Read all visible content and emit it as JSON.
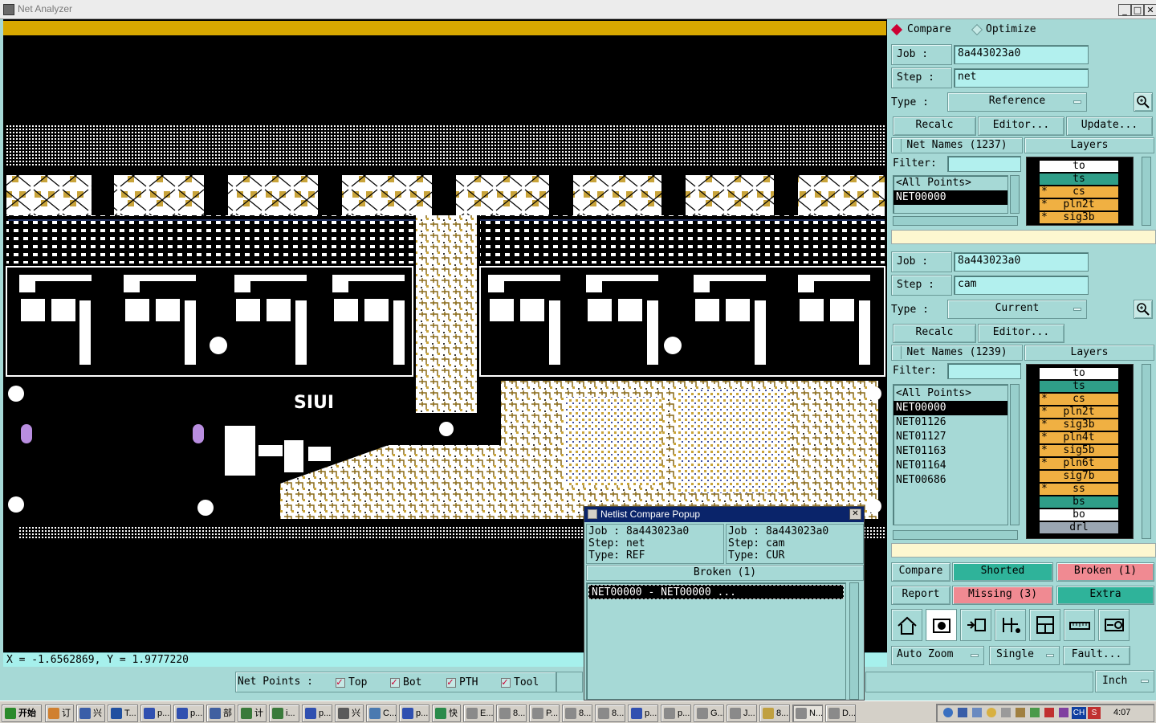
{
  "window": {
    "title": "Net Analyzer"
  },
  "coords": {
    "text": "X = -1.6562869, Y = 1.9777220"
  },
  "netpoints": {
    "label": "Net Points :",
    "top": "Top",
    "bot": "Bot",
    "pth": "PTH",
    "tool": "Tool"
  },
  "units": {
    "label": "Inch"
  },
  "mode": {
    "compare": "Compare",
    "optimize": "Optimize"
  },
  "ref": {
    "job_label": "Job  :",
    "job": "8a443023a0",
    "step_label": "Step  :",
    "step": "net",
    "type_label": "Type  :",
    "type": "Reference",
    "recalc": "Recalc",
    "editor": "Editor...",
    "update": "Update...",
    "netnames": "Net Names (1237)",
    "layers_label": "Layers",
    "filter_label": "Filter:",
    "nets": [
      "<All Points>",
      "NET00000"
    ],
    "layers": [
      {
        "name": "to",
        "star": "",
        "color": "#ffffff"
      },
      {
        "name": "ts",
        "star": "",
        "color": "#2f9e88"
      },
      {
        "name": "cs",
        "star": "*",
        "color": "#f0b042"
      },
      {
        "name": "pln2t",
        "star": "*",
        "color": "#f0b042"
      },
      {
        "name": "sig3b",
        "star": "*",
        "color": "#f0b042"
      }
    ]
  },
  "cur": {
    "job_label": "Job  :",
    "job": "8a443023a0",
    "step_label": "Step  :",
    "step": "cam",
    "type_label": "Type  :",
    "type": "Current",
    "recalc": "Recalc",
    "editor": "Editor...",
    "netnames": "Net Names (1239)",
    "layers_label": "Layers",
    "filter_label": "Filter:",
    "nets": [
      "<All Points>",
      "NET00000",
      "NET01126",
      "NET01127",
      "NET01163",
      "NET01164",
      "NET00686"
    ],
    "layers": [
      {
        "name": "to",
        "star": "",
        "color": "#ffffff"
      },
      {
        "name": "ts",
        "star": "",
        "color": "#2f9e88"
      },
      {
        "name": "cs",
        "star": "*",
        "color": "#f0b042"
      },
      {
        "name": "pln2t",
        "star": "*",
        "color": "#f0b042"
      },
      {
        "name": "sig3b",
        "star": "*",
        "color": "#f0b042"
      },
      {
        "name": "pln4t",
        "star": "*",
        "color": "#f0b042"
      },
      {
        "name": "sig5b",
        "star": "*",
        "color": "#f0b042"
      },
      {
        "name": "pln6t",
        "star": "*",
        "color": "#f0b042"
      },
      {
        "name": "sig7b",
        "star": "",
        "color": "#f0b042"
      },
      {
        "name": "ss",
        "star": "*",
        "color": "#f0b042"
      },
      {
        "name": "bs",
        "star": "",
        "color": "#2f9e88"
      },
      {
        "name": "bo",
        "star": "",
        "color": "#ffffff"
      },
      {
        "name": "drl",
        "star": "",
        "color": "#9aa6b2"
      }
    ]
  },
  "actions": {
    "compare": "Compare",
    "shorted": "Shorted",
    "broken": "Broken (1)",
    "report": "Report",
    "missing": "Missing (3)",
    "extra": "Extra",
    "autozoom": "Auto Zoom",
    "single": "Single",
    "fault": "Fault..."
  },
  "colors": {
    "green": "#2fb39a",
    "pink": "#f08a92",
    "panel": "#a6d9d6",
    "gold": "#d8a800"
  },
  "popup": {
    "title": "Netlist Compare Popup",
    "left": {
      "job": "Job  :  8a443023a0",
      "step": "Step:  net",
      "type": "Type:  REF"
    },
    "right": {
      "job": "Job  :  8a443023a0",
      "step": "Step:  cam",
      "type": "Type:  CUR"
    },
    "header": "Broken (1)",
    "row": "NET00000          - NET00000 ..."
  },
  "taskbar": {
    "start": "开始",
    "items": [
      "订",
      "兴",
      "T...",
      "p...",
      "p...",
      "部",
      "计",
      "i...",
      "p...",
      "兴",
      "C...",
      "p...",
      "快",
      "E...",
      "8...",
      "P...",
      "8...",
      "8...",
      "p...",
      "p...",
      "G...",
      "J...",
      "8...",
      "N...",
      "D..."
    ],
    "tray_lang": "CH",
    "clock": "4:07"
  }
}
